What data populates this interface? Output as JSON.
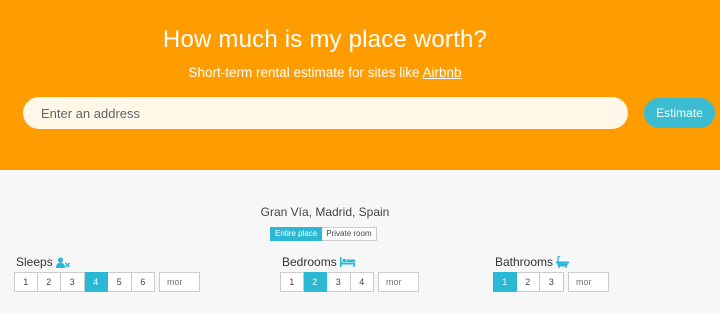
{
  "header": {
    "title": "How much is my place worth?",
    "subtitle_prefix": "Short-term rental estimate for sites like ",
    "subtitle_link": "Airbnb",
    "background_color": "#ff9c00"
  },
  "search": {
    "placeholder": "Enter an address",
    "button_label": "Estimate",
    "button_color": "#3bbcd0"
  },
  "location": "Gran Vía, Madrid, Spain",
  "room_type": {
    "options": [
      "Entire place",
      "Private room"
    ],
    "selected": "Entire place"
  },
  "accent_color": "#2bb8d5",
  "sleeps": {
    "label": "Sleeps",
    "icon": "users-icon",
    "options": [
      "1",
      "2",
      "3",
      "4",
      "5",
      "6"
    ],
    "selected": "4",
    "more_placeholder": "mor"
  },
  "bedrooms": {
    "label": "Bedrooms",
    "icon": "bed-icon",
    "options": [
      "1",
      "2",
      "3",
      "4"
    ],
    "selected": "2",
    "more_placeholder": "mor"
  },
  "bathrooms": {
    "label": "Bathrooms",
    "icon": "bathtub-icon",
    "options": [
      "1",
      "2",
      "3"
    ],
    "selected": "1",
    "more_placeholder": "mor"
  }
}
